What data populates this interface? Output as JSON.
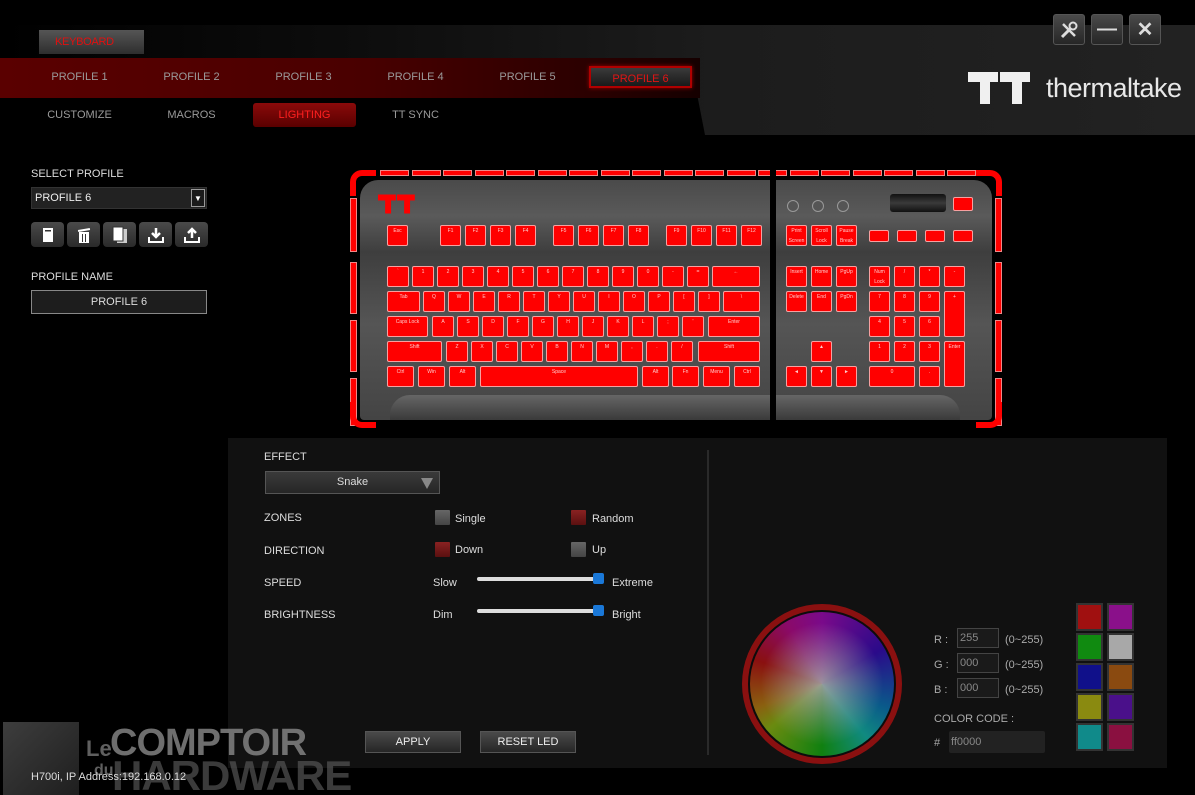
{
  "header": {
    "device_tab": "KEYBOARD",
    "profile_tabs": [
      {
        "label": "PROFILE 1",
        "active": false
      },
      {
        "label": "PROFILE 2",
        "active": false
      },
      {
        "label": "PROFILE 3",
        "active": false
      },
      {
        "label": "PROFILE 4",
        "active": false
      },
      {
        "label": "PROFILE 5",
        "active": false
      },
      {
        "label": "PROFILE 6",
        "active": true
      }
    ],
    "sub_tabs": [
      {
        "label": "CUSTOMIZE",
        "active": false
      },
      {
        "label": "MACROS",
        "active": false
      },
      {
        "label": "LIGHTING",
        "active": true
      },
      {
        "label": "TT SYNC",
        "active": false
      }
    ],
    "window_buttons": [
      "settings-icon",
      "minimize-icon",
      "close-icon"
    ],
    "brand": "thermaltake"
  },
  "sidebar": {
    "select_profile_label": "SELECT PROFILE",
    "selected_profile": "PROFILE 6",
    "profile_actions": [
      "new-profile-icon",
      "delete-icon",
      "copy-icon",
      "import-icon",
      "export-icon"
    ],
    "profile_name_label": "PROFILE NAME",
    "profile_name_value": "PROFILE 6"
  },
  "keyboard": {
    "led_color": "#ff0000",
    "rows": [
      [
        "Esc",
        "F1",
        "F2",
        "F3",
        "F4",
        "F5",
        "F6",
        "F7",
        "F8",
        "F9",
        "F10",
        "F11",
        "F12",
        "Print Screen",
        "Scroll Lock",
        "Pause Break"
      ],
      [
        "`",
        "1",
        "2",
        "3",
        "4",
        "5",
        "6",
        "7",
        "8",
        "9",
        "0",
        "-",
        "=",
        "←",
        "Insert",
        "Home",
        "PgUp",
        "Num Lock",
        "/",
        "*",
        "-"
      ],
      [
        "Tab",
        "Q",
        "W",
        "E",
        "R",
        "T",
        "Y",
        "U",
        "I",
        "O",
        "P",
        "[",
        "]",
        "\\",
        "Delete",
        "End",
        "PgDn",
        "7",
        "8",
        "9",
        "+"
      ],
      [
        "Caps Lock",
        "A",
        "S",
        "D",
        "F",
        "G",
        "H",
        "J",
        "K",
        "L",
        ";",
        "'",
        "Enter",
        "4",
        "5",
        "6"
      ],
      [
        "Shift",
        "Z",
        "X",
        "C",
        "V",
        "B",
        "N",
        "M",
        ",",
        ".",
        "/",
        "Shift",
        "▲",
        "1",
        "2",
        "3",
        "Enter"
      ],
      [
        "Ctrl",
        "Win",
        "Alt",
        "Space",
        "Alt",
        "Fn",
        "Menu",
        "Ctrl",
        "◄",
        "▼",
        "►",
        "0",
        "."
      ]
    ]
  },
  "lighting": {
    "effect_label": "EFFECT",
    "effect_value": "Snake",
    "zones_label": "ZONES",
    "zones_options": [
      {
        "label": "Single",
        "checked": false
      },
      {
        "label": "Random",
        "checked": true
      }
    ],
    "direction_label": "DIRECTION",
    "direction_options": [
      {
        "label": "Down",
        "checked": true
      },
      {
        "label": "Up",
        "checked": false
      }
    ],
    "speed_label": "SPEED",
    "speed_min": "Slow",
    "speed_max": "Extreme",
    "speed_value_pct": 100,
    "brightness_label": "BRIGHTNESS",
    "brightness_min": "Dim",
    "brightness_max": "Bright",
    "brightness_value_pct": 100,
    "apply_label": "APPLY",
    "reset_label": "RESET LED"
  },
  "color": {
    "r_label": "R :",
    "g_label": "G :",
    "b_label": "B :",
    "r_value": "255",
    "g_value": "000",
    "b_value": "000",
    "range_label": "(0~255)",
    "code_label": "COLOR CODE :",
    "hash": "#",
    "code_value": "ff0000",
    "swatches": [
      "#a01010",
      "#8a108a",
      "#108a10",
      "#a8a8a8",
      "#10108a",
      "#8a4a10",
      "#8a8a10",
      "#4a108a",
      "#108a8a",
      "#8a1040"
    ]
  },
  "status": "H700i, IP Address:192.168.0.12",
  "watermark": {
    "le": "Le",
    "comptoir": "COMPTOIR",
    "du": "du",
    "hardware": "HARDWARE"
  }
}
